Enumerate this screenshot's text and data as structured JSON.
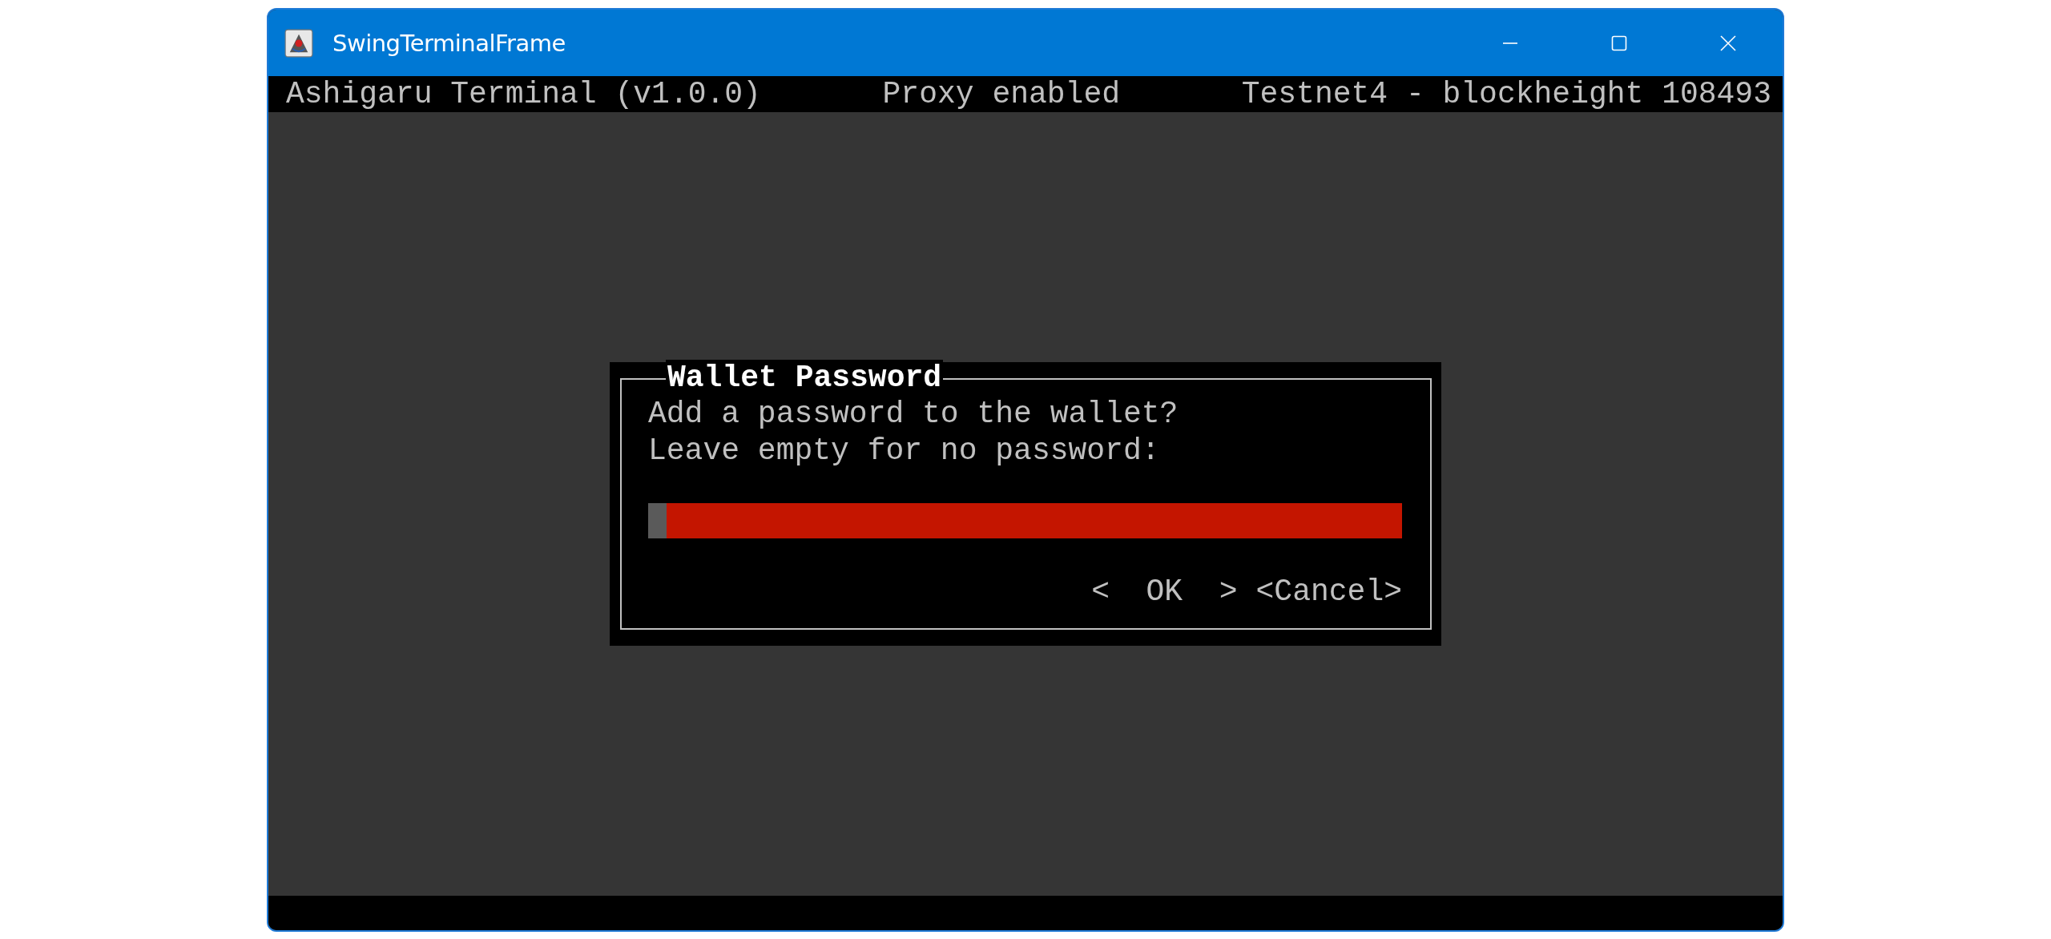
{
  "window": {
    "title": "SwingTerminalFrame"
  },
  "header": [
    "Ashigaru Terminal (v1.0.0)",
    "Proxy enabled",
    "Testnet4 - blockheight 108493"
  ],
  "dialog": {
    "title": "Wallet Password",
    "message": [
      "Add a password to the wallet?",
      "Leave empty for no password:"
    ],
    "password_field": {
      "focused": true
    },
    "buttons": [
      {
        "label": "<  OK  >"
      },
      {
        "label": "<Cancel>"
      }
    ]
  }
}
